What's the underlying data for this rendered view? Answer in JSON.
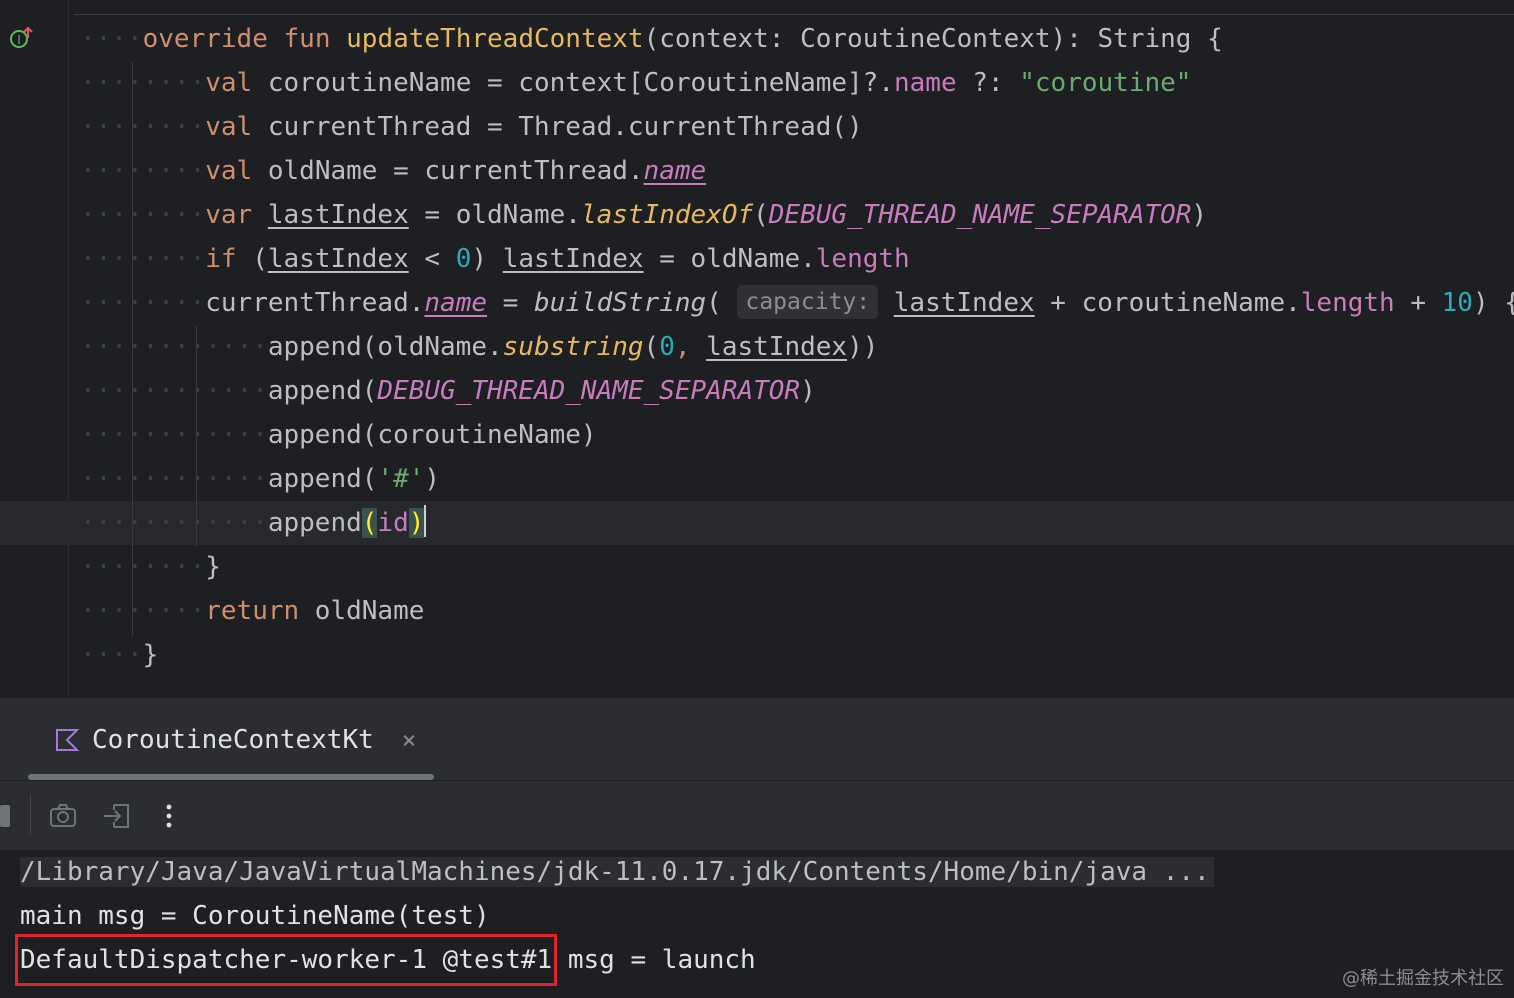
{
  "editor": {
    "lines": [
      {
        "indent": "····",
        "tokens": [
          [
            "kw",
            "override"
          ],
          [
            "",
            "·"
          ],
          [
            "kw",
            "fun"
          ],
          [
            "",
            "·"
          ],
          [
            "fn",
            "updateThreadContext"
          ],
          [
            "",
            "(context:·CoroutineContext):·String·{"
          ]
        ]
      },
      {
        "indent": "········",
        "tokens": [
          [
            "kw",
            "val"
          ],
          [
            "",
            "·coroutineName·=·context[CoroutineName]?."
          ],
          [
            "prop",
            "name"
          ],
          [
            "",
            "·?:·"
          ],
          [
            "str",
            "\"coroutine\""
          ]
        ]
      },
      {
        "indent": "········",
        "tokens": [
          [
            "kw",
            "val"
          ],
          [
            "",
            "·currentThread·=·Thread.currentThread()"
          ]
        ]
      },
      {
        "indent": "········",
        "tokens": [
          [
            "kw",
            "val"
          ],
          [
            "",
            "·oldName·=·currentThread."
          ],
          [
            "prop ital ul",
            "name"
          ]
        ]
      },
      {
        "indent": "········",
        "tokens": [
          [
            "kw",
            "var"
          ],
          [
            "",
            "·"
          ],
          [
            "ul",
            "lastIndex"
          ],
          [
            "",
            "·=·oldName."
          ],
          [
            "itfn",
            "lastIndexOf"
          ],
          [
            "",
            "("
          ],
          [
            "const",
            "DEBUG_THREAD_NAME_SEPARATOR"
          ],
          [
            "",
            ")"
          ]
        ]
      },
      {
        "indent": "········",
        "tokens": [
          [
            "kw",
            "if"
          ],
          [
            "",
            "·("
          ],
          [
            "ul",
            "lastIndex"
          ],
          [
            "",
            "·<·"
          ],
          [
            "num",
            "0"
          ],
          [
            "",
            ")·"
          ],
          [
            "ul",
            "lastIndex"
          ],
          [
            "",
            "·=·oldName."
          ],
          [
            "prop",
            "length"
          ]
        ]
      },
      {
        "indent": "········",
        "tokens": [
          [
            "",
            "currentThread."
          ],
          [
            "prop ital ul",
            "name"
          ],
          [
            "",
            "·=·"
          ],
          [
            "ital",
            "buildString"
          ],
          [
            "",
            "(·"
          ],
          [
            "hint",
            "capacity:"
          ],
          [
            "",
            "·"
          ],
          [
            "ul",
            "lastIndex"
          ],
          [
            "",
            "·+·coroutineName."
          ],
          [
            "prop",
            "length"
          ],
          [
            "",
            "·+·"
          ],
          [
            "num",
            "10"
          ],
          [
            "",
            ")·{·"
          ]
        ]
      },
      {
        "indent": "············",
        "tokens": [
          [
            "",
            "append(oldName."
          ],
          [
            "itfn",
            "substring"
          ],
          [
            "",
            "("
          ],
          [
            "num",
            "0"
          ],
          [
            "kw",
            ",·"
          ],
          [
            "ul",
            "lastIndex"
          ],
          [
            "",
            "))"
          ]
        ]
      },
      {
        "indent": "············",
        "tokens": [
          [
            "",
            "append("
          ],
          [
            "const",
            "DEBUG_THREAD_NAME_SEPARATOR"
          ],
          [
            "",
            ")"
          ]
        ]
      },
      {
        "indent": "············",
        "tokens": [
          [
            "",
            "append(coroutineName)"
          ]
        ]
      },
      {
        "indent": "············",
        "tokens": [
          [
            "",
            "append("
          ],
          [
            "str",
            "'#'"
          ],
          [
            "",
            ")"
          ]
        ]
      },
      {
        "indent": "············",
        "tokens": [
          [
            "",
            "append"
          ],
          [
            "brace-hl",
            "("
          ],
          [
            "prop",
            "id"
          ],
          [
            "brace-hl",
            ")"
          ],
          [
            "caret",
            ""
          ]
        ],
        "current": true
      },
      {
        "indent": "········",
        "tokens": [
          [
            "",
            "}"
          ]
        ]
      },
      {
        "indent": "········",
        "tokens": [
          [
            "kw",
            "return"
          ],
          [
            "",
            "·oldName"
          ]
        ]
      },
      {
        "indent": "····",
        "tokens": [
          [
            "",
            "}"
          ]
        ]
      }
    ]
  },
  "toolwindow": {
    "tab_label": "CoroutineContextKt",
    "tab_close": "×"
  },
  "console": {
    "lines": [
      "/Library/Java/JavaVirtualMachines/jdk-11.0.17.jdk/Contents/Home/bin/java ...",
      "main msg = CoroutineName(test)",
      "DefaultDispatcher-worker-1 @test#1 msg = launch"
    ]
  },
  "watermark": "@稀土掘金技术社区"
}
